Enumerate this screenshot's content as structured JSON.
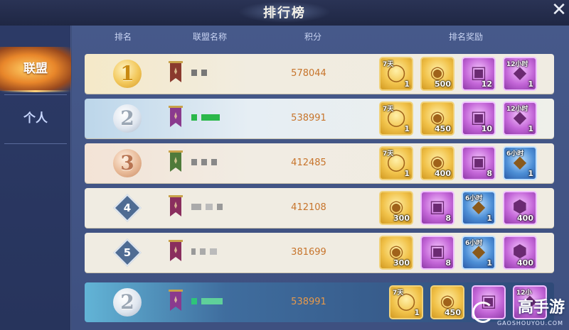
{
  "window": {
    "title": "排行榜",
    "close_icon": "close-icon"
  },
  "sidebar": {
    "tabs": [
      {
        "label": "联盟",
        "active": true
      },
      {
        "label": "个人",
        "active": false
      }
    ]
  },
  "table": {
    "headers": {
      "rank": "排名",
      "alliance_name": "联盟名称",
      "score": "积分",
      "rewards": "排名奖励"
    },
    "rows": [
      {
        "rank": "1",
        "rank_style": "gold-medal",
        "banner_color": "#8a3a2e",
        "score": "578044",
        "rewards": [
          {
            "icon": "ring-icon",
            "style": "gold",
            "duration": "7天",
            "count": "1"
          },
          {
            "icon": "coin-icon",
            "style": "gold",
            "duration": "",
            "count": "500"
          },
          {
            "icon": "chest-icon",
            "style": "purple",
            "duration": "",
            "count": "12"
          },
          {
            "icon": "bag-icon",
            "style": "purple",
            "duration": "12小时",
            "count": "1"
          }
        ]
      },
      {
        "rank": "2",
        "rank_style": "silver-medal",
        "banner_color": "#8a3a8e",
        "score": "538991",
        "rewards": [
          {
            "icon": "ring-icon",
            "style": "gold",
            "duration": "7天",
            "count": "1"
          },
          {
            "icon": "coin-icon",
            "style": "gold",
            "duration": "",
            "count": "450"
          },
          {
            "icon": "chest-icon",
            "style": "purple",
            "duration": "",
            "count": "10"
          },
          {
            "icon": "bag-icon",
            "style": "purple",
            "duration": "12小时",
            "count": "1"
          }
        ]
      },
      {
        "rank": "3",
        "rank_style": "bronze-medal",
        "banner_color": "#4f7a3a",
        "score": "412485",
        "rewards": [
          {
            "icon": "ring-icon",
            "style": "gold",
            "duration": "7天",
            "count": "1"
          },
          {
            "icon": "coin-icon",
            "style": "gold",
            "duration": "",
            "count": "400"
          },
          {
            "icon": "chest-icon",
            "style": "purple",
            "duration": "",
            "count": "8"
          },
          {
            "icon": "bag-icon",
            "style": "blue",
            "duration": "6小时",
            "count": "1"
          }
        ]
      },
      {
        "rank": "4",
        "rank_style": "diamond",
        "banner_color": "#8a2e5e",
        "score": "412108",
        "rewards": [
          {
            "icon": "coin-icon",
            "style": "gold",
            "duration": "",
            "count": "300"
          },
          {
            "icon": "chest-icon",
            "style": "purple",
            "duration": "",
            "count": "8"
          },
          {
            "icon": "bag-icon",
            "style": "blue",
            "duration": "6小时",
            "count": "1"
          },
          {
            "icon": "crystal-icon",
            "style": "purple",
            "duration": "",
            "count": "400"
          }
        ]
      },
      {
        "rank": "5",
        "rank_style": "diamond",
        "banner_color": "#8a2e5e",
        "score": "381699",
        "rewards": [
          {
            "icon": "coin-icon",
            "style": "gold",
            "duration": "",
            "count": "300"
          },
          {
            "icon": "chest-icon",
            "style": "purple",
            "duration": "",
            "count": "8"
          },
          {
            "icon": "bag-icon",
            "style": "blue",
            "duration": "6小时",
            "count": "1"
          },
          {
            "icon": "crystal-icon",
            "style": "purple",
            "duration": "",
            "count": "400"
          }
        ]
      }
    ],
    "my_row": {
      "rank": "2",
      "rank_style": "silver-medal",
      "banner_color": "#8a3a8e",
      "score": "538991",
      "rewards": [
        {
          "icon": "ring-icon",
          "style": "gold",
          "duration": "7天",
          "count": "1"
        },
        {
          "icon": "coin-icon",
          "style": "gold",
          "duration": "",
          "count": "450"
        },
        {
          "icon": "chest-icon",
          "style": "purple",
          "duration": "",
          "count": ""
        },
        {
          "icon": "bag-icon",
          "style": "purple",
          "duration": "12小",
          "count": ""
        }
      ]
    }
  },
  "watermark": {
    "text": "高手游",
    "sub": "GAOSHOUYOU.COM"
  }
}
